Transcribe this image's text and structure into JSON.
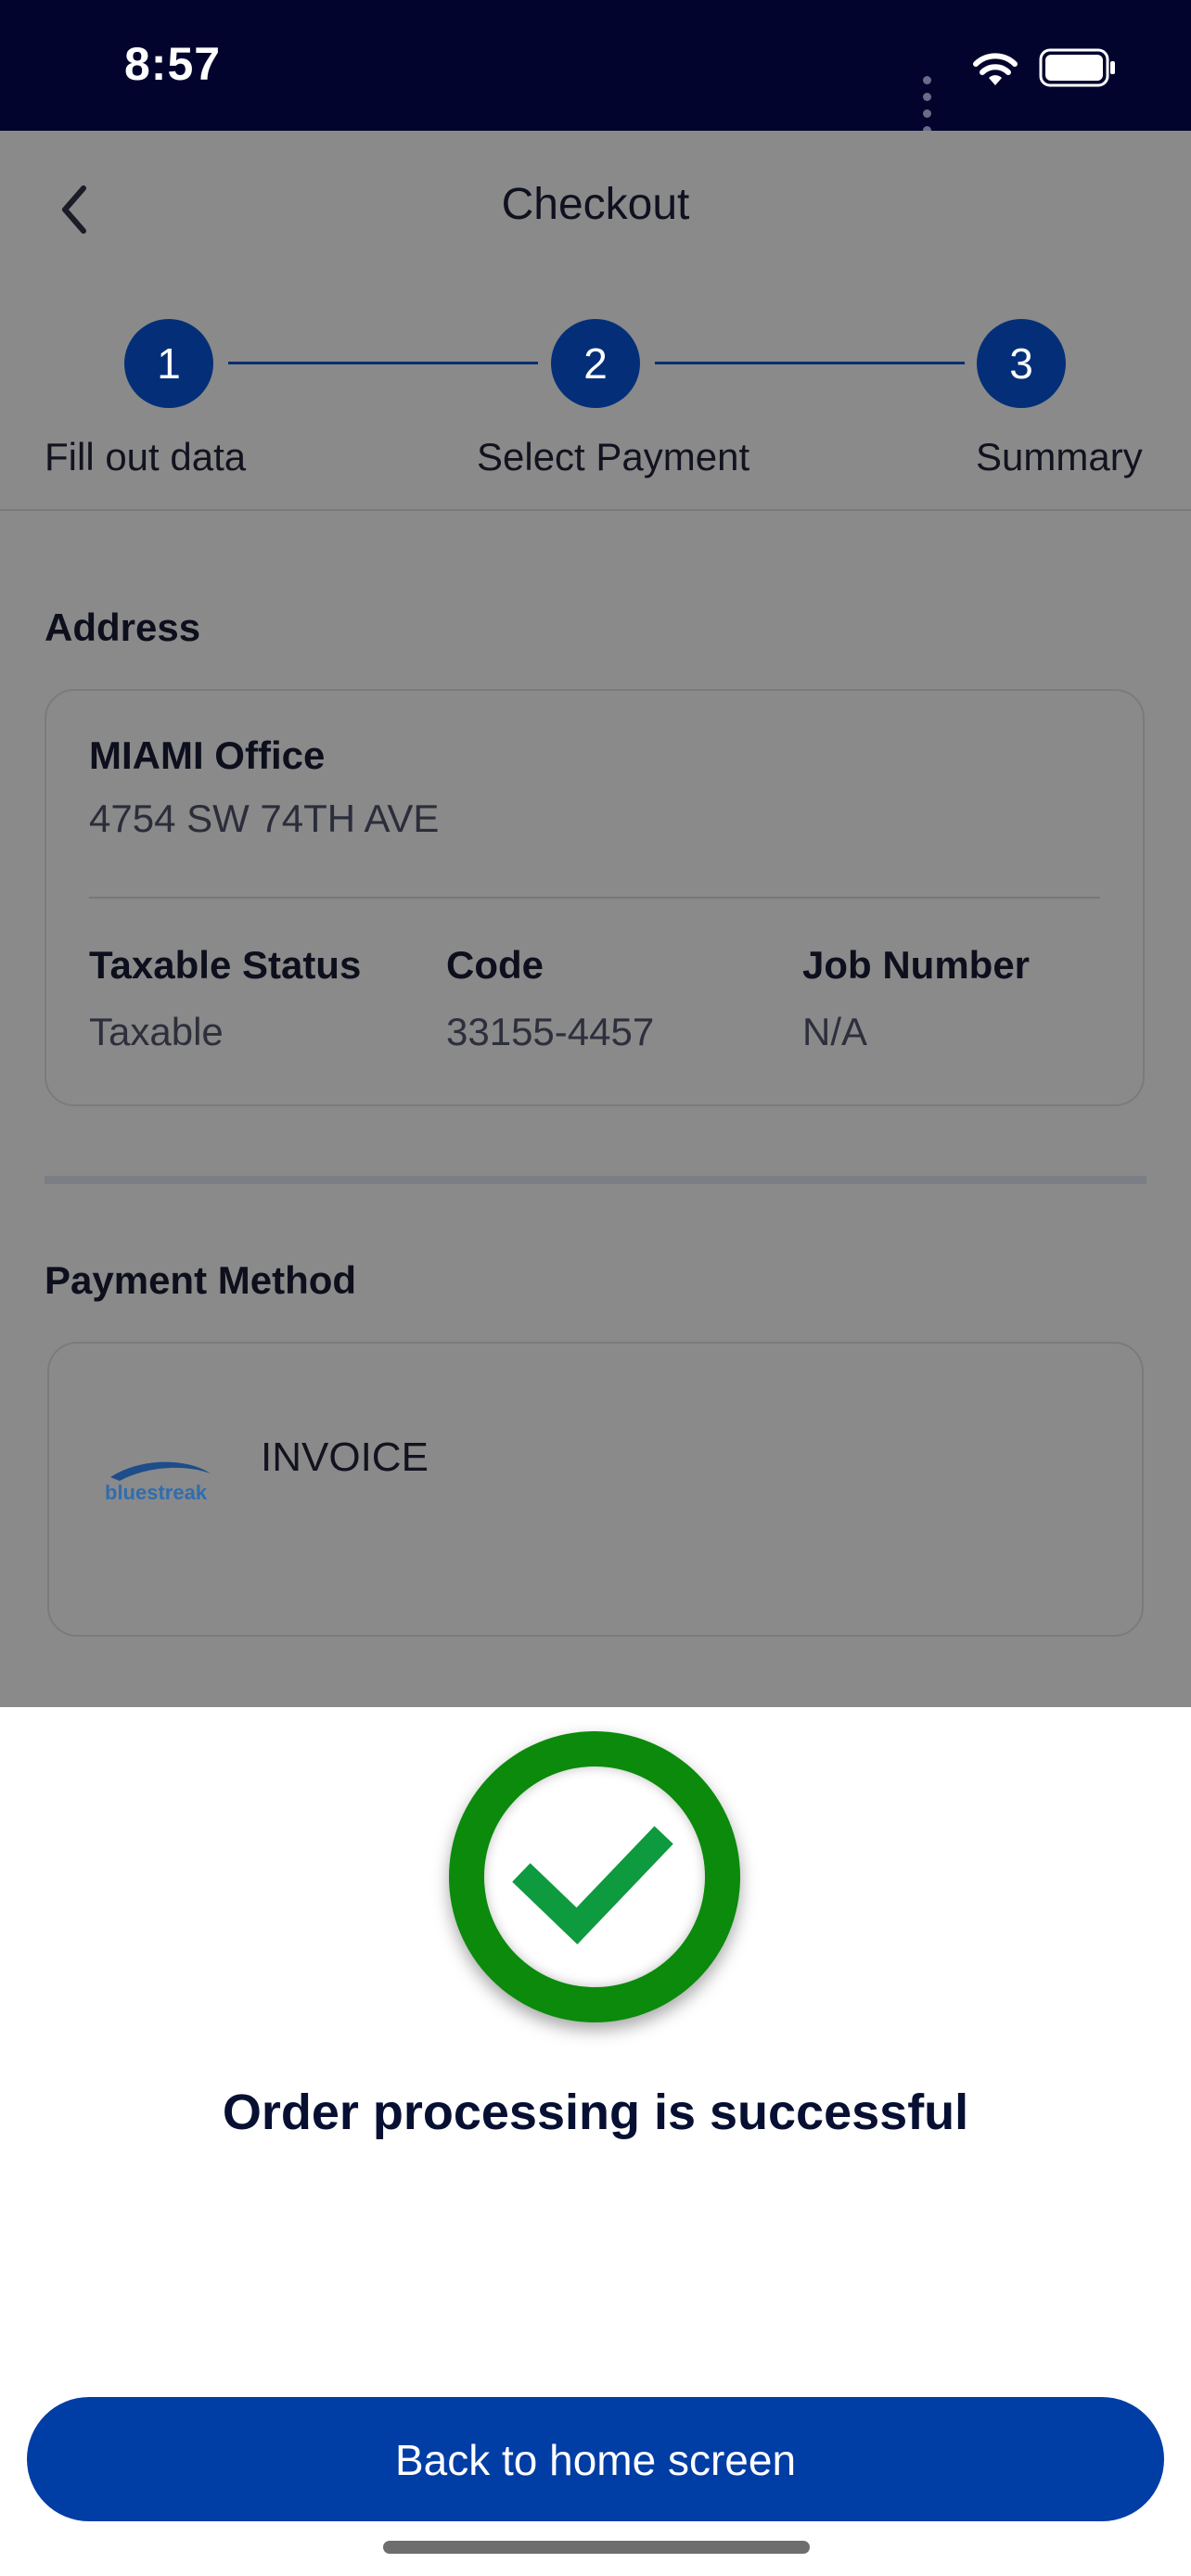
{
  "status_bar": {
    "time": "8:57"
  },
  "header": {
    "title": "Checkout"
  },
  "stepper": {
    "steps": [
      {
        "number": "1",
        "label": "Fill out data"
      },
      {
        "number": "2",
        "label": "Select Payment"
      },
      {
        "number": "3",
        "label": "Summary"
      }
    ]
  },
  "address": {
    "section_label": "Address",
    "name": "MIAMI Office",
    "line": "4754 SW 74TH AVE",
    "taxable_status_label": "Taxable Status",
    "taxable_status_value": "Taxable",
    "code_label": "Code",
    "code_value": "33155-4457",
    "job_number_label": "Job Number",
    "job_number_value": "N/A"
  },
  "payment": {
    "section_label": "Payment Method",
    "method": "INVOICE",
    "logo_text": "bluestreak"
  },
  "result": {
    "message": "Order processing is successful",
    "button_label": "Back to home screen"
  },
  "colors": {
    "status_bar": "#03042e",
    "primary": "#042f78",
    "button": "#003da5",
    "success": "#0b8a0b"
  }
}
